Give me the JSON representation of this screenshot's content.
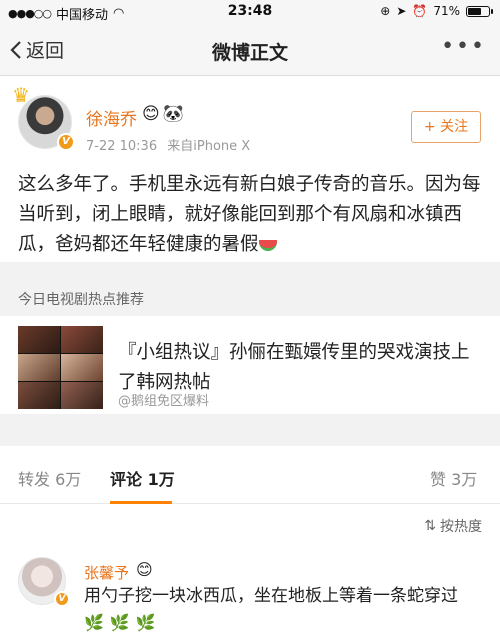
{
  "status_bar": {
    "carrier": "中国移动",
    "time": "23:48",
    "battery": "71%",
    "battery_level": 0.71
  },
  "nav": {
    "back_label": "返回",
    "title": "微博正文",
    "more_label": "•••"
  },
  "post": {
    "author": "徐海乔",
    "time": "7-22 10:36",
    "source": "来自iPhone X",
    "follow_label": "+ 关注",
    "text": "这么多年了。手机里永远有新白娘子传奇的音乐。因为每当听到，闭上眼睛，就好像能回到那个有风扇和冰镇西瓜，爸妈都还年轻健康的暑假"
  },
  "hot": {
    "section_title": "今日电视剧热点推荐",
    "card_title": "『小组热议』孙俪在甄嬛传里的哭戏演技上了韩网热帖",
    "card_source": "@鹅组免区爆料"
  },
  "tabs": {
    "repost": "转发 6万",
    "comment": "评论 1万",
    "like": "赞 3万"
  },
  "sort": {
    "label": "按热度"
  },
  "comment": {
    "author": "张馨予",
    "text": "用勺子挖一块冰西瓜，坐在地板上等着一条蛇穿过",
    "emojis": "🌿🌿🌿"
  }
}
